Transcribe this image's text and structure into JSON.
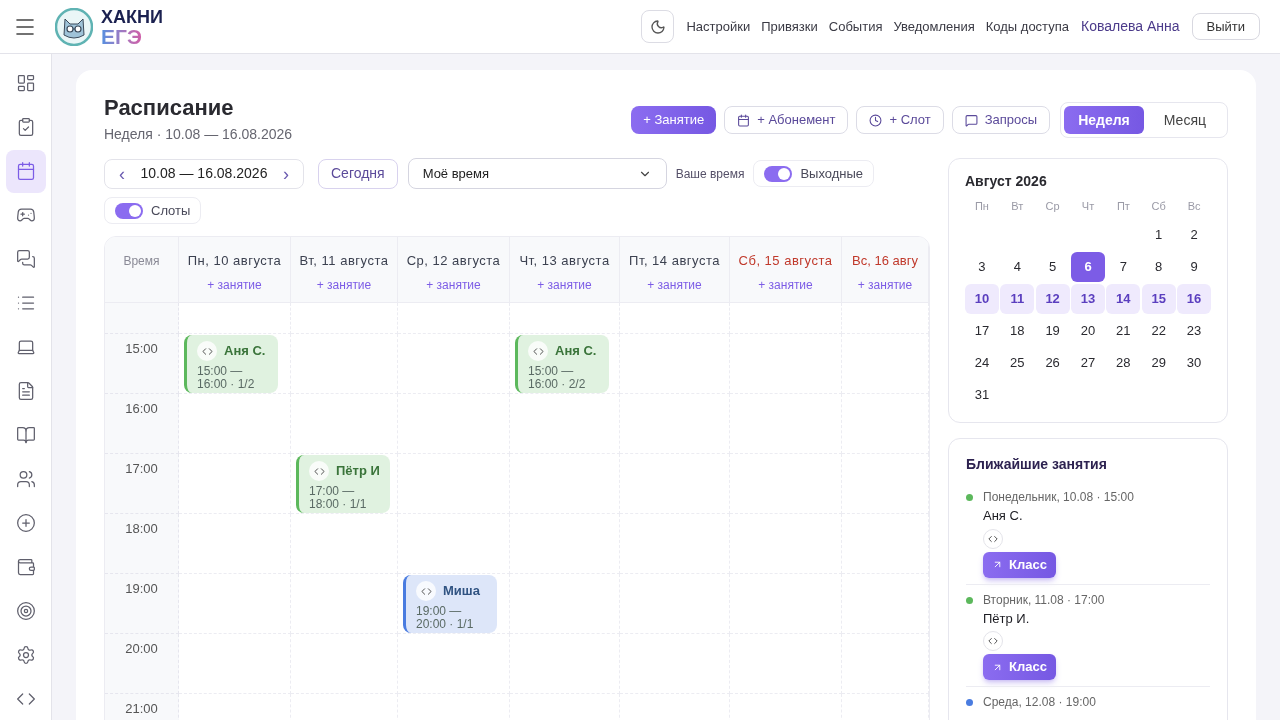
{
  "header": {
    "logo_line1": "ХАКНИ",
    "logo_line2": "ЕГЭ",
    "nav": [
      "Настройки",
      "Привязки",
      "События",
      "Уведомления",
      "Коды доступа"
    ],
    "user": "Ковалева Анна",
    "logout": "Выйти"
  },
  "sidebar": {
    "items": [
      {
        "selected": false
      },
      {
        "selected": false
      },
      {
        "selected": true
      },
      {
        "selected": false
      },
      {
        "selected": false
      },
      {
        "selected": false
      },
      {
        "selected": false
      },
      {
        "selected": false
      },
      {
        "selected": false
      },
      {
        "selected": false
      },
      {
        "selected": false
      },
      {
        "selected": false
      },
      {
        "selected": false
      },
      {
        "selected": false
      },
      {
        "selected": false
      }
    ]
  },
  "page": {
    "title": "Расписание",
    "subtitle": "Неделя · 10.08 — 16.08.2026"
  },
  "actions": [
    {
      "kind": "primary",
      "label": "+ Занятие"
    },
    {
      "kind": "subscription",
      "label": "+ Абонемент"
    },
    {
      "kind": "slot",
      "label": "+ Слот"
    },
    {
      "kind": "requests",
      "label": "Запросы"
    }
  ],
  "view_tabs": [
    {
      "label": "Неделя",
      "selected": true
    },
    {
      "label": "Месяц",
      "selected": false
    }
  ],
  "range": {
    "prev": "‹",
    "label": "10.08 — 16.08.2026",
    "next": "›"
  },
  "today": "Сегодня",
  "time_select": {
    "value": "Моё время"
  },
  "time_hint": "Ваше время",
  "toggles": [
    {
      "label": "Выходные",
      "on": true
    },
    {
      "label": "Слоты",
      "on": true
    }
  ],
  "schedule": {
    "time_header": "Время",
    "days": [
      {
        "label": "Пн, 10 августа",
        "add": "+ занятие",
        "weekend": false
      },
      {
        "label": "Вт, 11 августа",
        "add": "+ занятие",
        "weekend": false
      },
      {
        "label": "Ср, 12 августа",
        "add": "+ занятие",
        "weekend": false
      },
      {
        "label": "Чт, 13 августа",
        "add": "+ занятие",
        "weekend": false
      },
      {
        "label": "Пт, 14 августа",
        "add": "+ занятие",
        "weekend": false
      },
      {
        "label": "Сб, 15 августа",
        "add": "+ занятие",
        "weekend": true
      },
      {
        "label": "Вс, 16 авгу",
        "add": "+ занятие",
        "weekend": true
      }
    ],
    "rows": [
      {
        "cells": [
          {
            "kind": "empty"
          },
          {
            "kind": "empty"
          },
          {
            "kind": "empty"
          },
          {
            "kind": "empty"
          },
          {
            "kind": "empty"
          },
          {
            "kind": "empty"
          },
          {
            "kind": "empty"
          }
        ]
      },
      {
        "time": "15:00",
        "cells": [
          {
            "kind": "lesson",
            "color": "#5cb85c",
            "name": "Аня С.",
            "time": "15:00 — 16:00 · 1/2"
          },
          {
            "kind": "empty"
          },
          {
            "kind": "empty"
          },
          {
            "kind": "lesson",
            "color": "#5cb85c",
            "name": "Аня С.",
            "time": "15:00 — 16:00 · 2/2"
          },
          {
            "kind": "empty"
          },
          {
            "kind": "empty"
          },
          {
            "kind": "empty"
          }
        ]
      },
      {
        "time": "16:00",
        "cells": [
          {
            "kind": "empty"
          },
          {
            "kind": "empty"
          },
          {
            "kind": "empty"
          },
          {
            "kind": "empty"
          },
          {
            "kind": "empty"
          },
          {
            "kind": "empty"
          },
          {
            "kind": "empty"
          }
        ]
      },
      {
        "time": "17:00",
        "cells": [
          {
            "kind": "empty"
          },
          {
            "kind": "lesson",
            "color": "#5cb85c",
            "name": "Пётр И",
            "time": "17:00 — 18:00 · 1/1"
          },
          {
            "kind": "empty"
          },
          {
            "kind": "empty"
          },
          {
            "kind": "empty"
          },
          {
            "kind": "empty"
          },
          {
            "kind": "empty"
          }
        ]
      },
      {
        "time": "18:00",
        "cells": [
          {
            "kind": "empty"
          },
          {
            "kind": "empty"
          },
          {
            "kind": "empty"
          },
          {
            "kind": "empty"
          },
          {
            "kind": "empty"
          },
          {
            "kind": "empty"
          },
          {
            "kind": "empty"
          }
        ]
      },
      {
        "time": "19:00",
        "cells": [
          {
            "kind": "empty"
          },
          {
            "kind": "empty"
          },
          {
            "kind": "lesson",
            "color": "#4a7ce0",
            "name": "Миша",
            "time": "19:00 — 20:00 · 1/1"
          },
          {
            "kind": "empty"
          },
          {
            "kind": "empty"
          },
          {
            "kind": "empty"
          },
          {
            "kind": "empty"
          }
        ]
      },
      {
        "time": "20:00",
        "cells": [
          {
            "kind": "empty"
          },
          {
            "kind": "empty"
          },
          {
            "kind": "empty"
          },
          {
            "kind": "empty"
          },
          {
            "kind": "empty"
          },
          {
            "kind": "empty"
          },
          {
            "kind": "empty"
          }
        ]
      },
      {
        "time": "21:00",
        "cells": [
          {
            "kind": "empty"
          },
          {
            "kind": "empty"
          },
          {
            "kind": "empty"
          },
          {
            "kind": "empty"
          },
          {
            "kind": "empty"
          },
          {
            "kind": "empty"
          },
          {
            "kind": "empty"
          }
        ]
      }
    ]
  },
  "mini_calendar": {
    "title": "Август 2026",
    "weekdays": [
      "Пн",
      "Вт",
      "Ср",
      "Чт",
      "Пт",
      "Сб",
      "Вс"
    ],
    "weeks": [
      [
        {
          "kind": "blank"
        },
        {
          "kind": "blank"
        },
        {
          "kind": "blank"
        },
        {
          "kind": "blank"
        },
        {
          "kind": "blank"
        },
        {
          "kind": "day",
          "day": "1",
          "selected": false,
          "in_week": false
        },
        {
          "kind": "day",
          "day": "2",
          "selected": false,
          "in_week": false
        }
      ],
      [
        {
          "kind": "day",
          "day": "3",
          "selected": false,
          "in_week": false
        },
        {
          "kind": "day",
          "day": "4",
          "selected": false,
          "in_week": false
        },
        {
          "kind": "day",
          "day": "5",
          "selected": false,
          "in_week": false
        },
        {
          "kind": "day",
          "day": "6",
          "selected": true,
          "in_week": false
        },
        {
          "kind": "day",
          "day": "7",
          "selected": false,
          "in_week": false
        },
        {
          "kind": "day",
          "day": "8",
          "selected": false,
          "in_week": false
        },
        {
          "kind": "day",
          "day": "9",
          "selected": false,
          "in_week": false
        }
      ],
      [
        {
          "kind": "day",
          "day": "10",
          "selected": false,
          "in_week": true
        },
        {
          "kind": "day",
          "day": "11",
          "selected": false,
          "in_week": true
        },
        {
          "kind": "day",
          "day": "12",
          "selected": false,
          "in_week": true
        },
        {
          "kind": "day",
          "day": "13",
          "selected": false,
          "in_week": true
        },
        {
          "kind": "day",
          "day": "14",
          "selected": false,
          "in_week": true
        },
        {
          "kind": "day",
          "day": "15",
          "selected": false,
          "in_week": true
        },
        {
          "kind": "day",
          "day": "16",
          "selected": false,
          "in_week": true
        }
      ],
      [
        {
          "kind": "day",
          "day": "17",
          "selected": false,
          "in_week": false
        },
        {
          "kind": "day",
          "day": "18",
          "selected": false,
          "in_week": false
        },
        {
          "kind": "day",
          "day": "19",
          "selected": false,
          "in_week": false
        },
        {
          "kind": "day",
          "day": "20",
          "selected": false,
          "in_week": false
        },
        {
          "kind": "day",
          "day": "21",
          "selected": false,
          "in_week": false
        },
        {
          "kind": "day",
          "day": "22",
          "selected": false,
          "in_week": false
        },
        {
          "kind": "day",
          "day": "23",
          "selected": false,
          "in_week": false
        }
      ],
      [
        {
          "kind": "day",
          "day": "24",
          "selected": false,
          "in_week": false
        },
        {
          "kind": "day",
          "day": "25",
          "selected": false,
          "in_week": false
        },
        {
          "kind": "day",
          "day": "26",
          "selected": false,
          "in_week": false
        },
        {
          "kind": "day",
          "day": "27",
          "selected": false,
          "in_week": false
        },
        {
          "kind": "day",
          "day": "28",
          "selected": false,
          "in_week": false
        },
        {
          "kind": "day",
          "day": "29",
          "selected": false,
          "in_week": false
        },
        {
          "kind": "day",
          "day": "30",
          "selected": false,
          "in_week": false
        }
      ],
      [
        {
          "kind": "day",
          "day": "31",
          "selected": false,
          "in_week": false
        }
      ]
    ]
  },
  "upcoming": {
    "title": "Ближайшие занятия",
    "items": [
      {
        "color": "#5cb85c",
        "when": "Понедельник, 10.08 · 15:00",
        "name": "Аня С.",
        "button": "Класс"
      },
      {
        "color": "#5cb85c",
        "when": "Вторник, 11.08 · 17:00",
        "name": "Пётр И.",
        "button": "Класс"
      },
      {
        "color": "#4a7ce0",
        "when": "Среда, 12.08 · 19:00"
      }
    ]
  }
}
